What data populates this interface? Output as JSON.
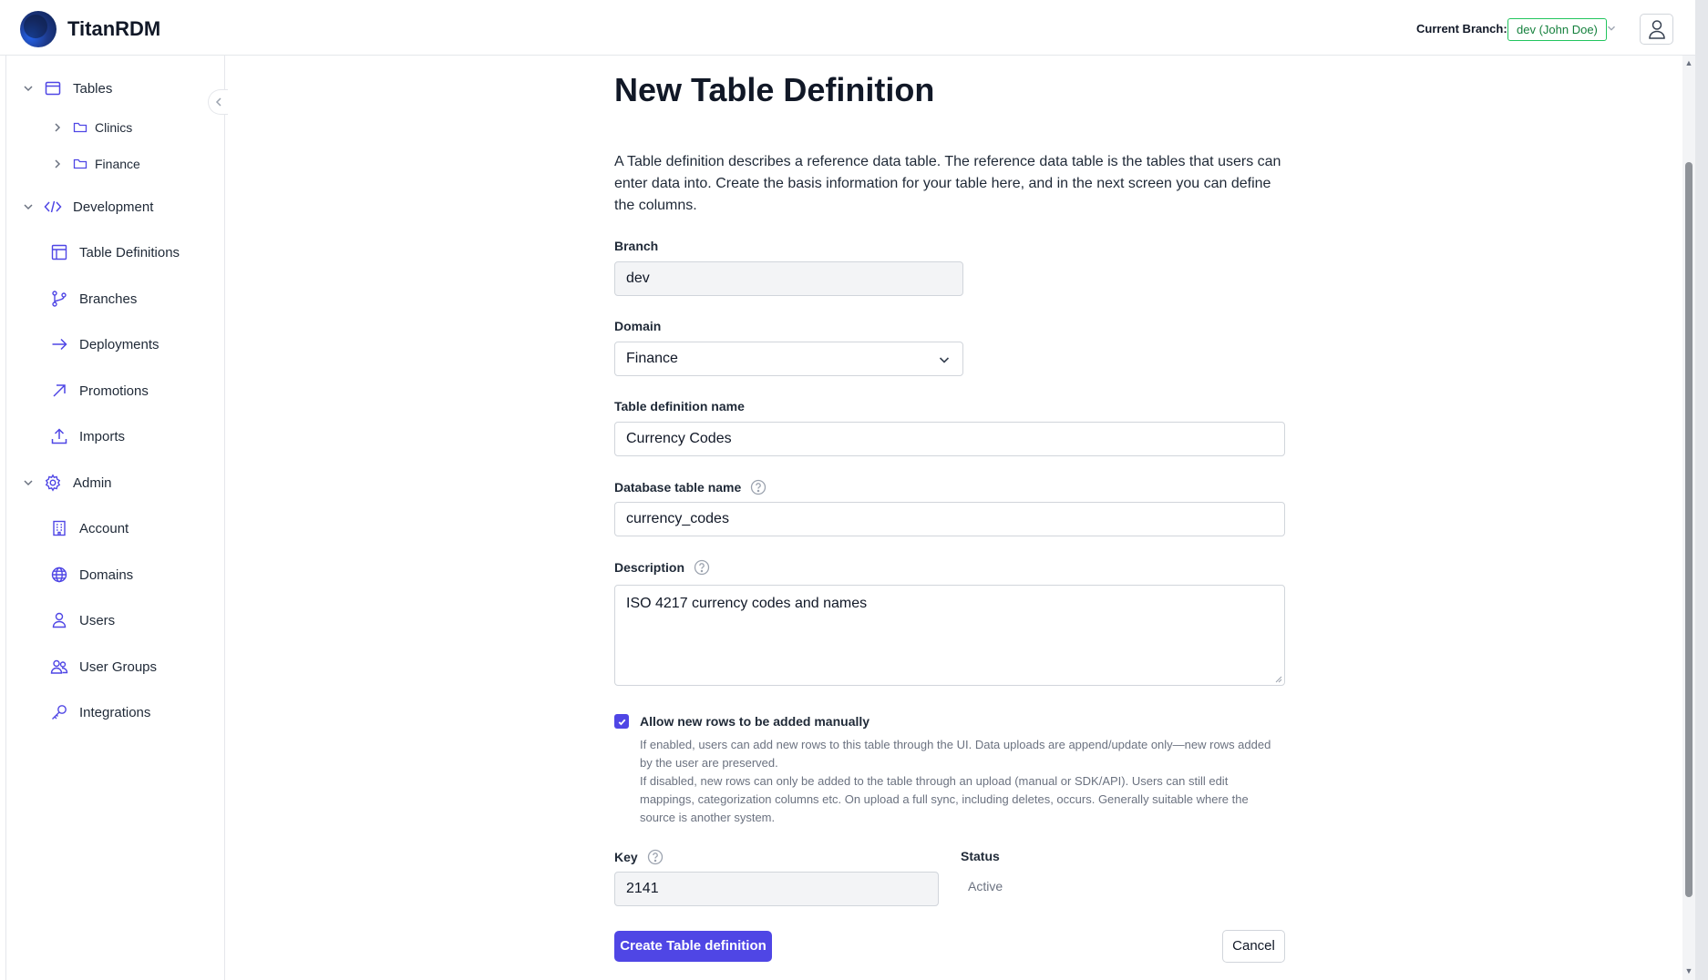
{
  "app": {
    "name": "TitanRDM"
  },
  "header": {
    "branch_label": "Current Branch:",
    "branch_value": "dev (John Doe)"
  },
  "sidebar": {
    "groups": [
      {
        "label": "Tables",
        "icon": "table-window-icon",
        "expanded": true,
        "items": [
          {
            "label": "Clinics",
            "icon": "folder-icon"
          },
          {
            "label": "Finance",
            "icon": "folder-icon"
          }
        ]
      },
      {
        "label": "Development",
        "icon": "code-icon",
        "expanded": true,
        "items": [
          {
            "label": "Table Definitions",
            "icon": "table-grid-icon"
          },
          {
            "label": "Branches",
            "icon": "git-branch-icon"
          },
          {
            "label": "Deployments",
            "icon": "arrow-right-icon"
          },
          {
            "label": "Promotions",
            "icon": "arrow-up-right-icon"
          },
          {
            "label": "Imports",
            "icon": "upload-icon"
          }
        ]
      },
      {
        "label": "Admin",
        "icon": "gear-icon",
        "expanded": true,
        "items": [
          {
            "label": "Account",
            "icon": "building-icon"
          },
          {
            "label": "Domains",
            "icon": "globe-icon"
          },
          {
            "label": "Users",
            "icon": "user-icon"
          },
          {
            "label": "User Groups",
            "icon": "users-icon"
          },
          {
            "label": "Integrations",
            "icon": "key-icon"
          }
        ]
      }
    ]
  },
  "form": {
    "title": "New Table Definition",
    "intro": "A Table definition describes a reference data table. The reference data table is the tables that users can enter data into. Create the basis information for your table here, and in the next screen you can define the columns.",
    "branch": {
      "label": "Branch",
      "value": "dev"
    },
    "domain": {
      "label": "Domain",
      "value": "Finance"
    },
    "table_name": {
      "label": "Table definition name",
      "value": "Currency Codes"
    },
    "db_table_name": {
      "label": "Database table name",
      "value": "currency_codes"
    },
    "description": {
      "label": "Description",
      "value": "ISO 4217 currency codes and names"
    },
    "allow_rows": {
      "label": "Allow new rows to be added manually",
      "checked": true,
      "help_enabled": "If enabled, users can add new rows to this table through the UI. Data uploads are append/update only—new rows added by the user are preserved.",
      "help_disabled": "If disabled, new rows can only be added to the table through an upload (manual or SDK/API). Users can still edit mappings, categorization columns etc. On upload a full sync, including deletes, occurs. Generally suitable where the source is another system."
    },
    "key": {
      "label": "Key",
      "value": "2141"
    },
    "status": {
      "label": "Status",
      "value": "Active"
    },
    "submit_label": "Create Table definition",
    "cancel_label": "Cancel"
  },
  "colors": {
    "accent": "#4f46e5",
    "branch_pill": "#15803d"
  }
}
